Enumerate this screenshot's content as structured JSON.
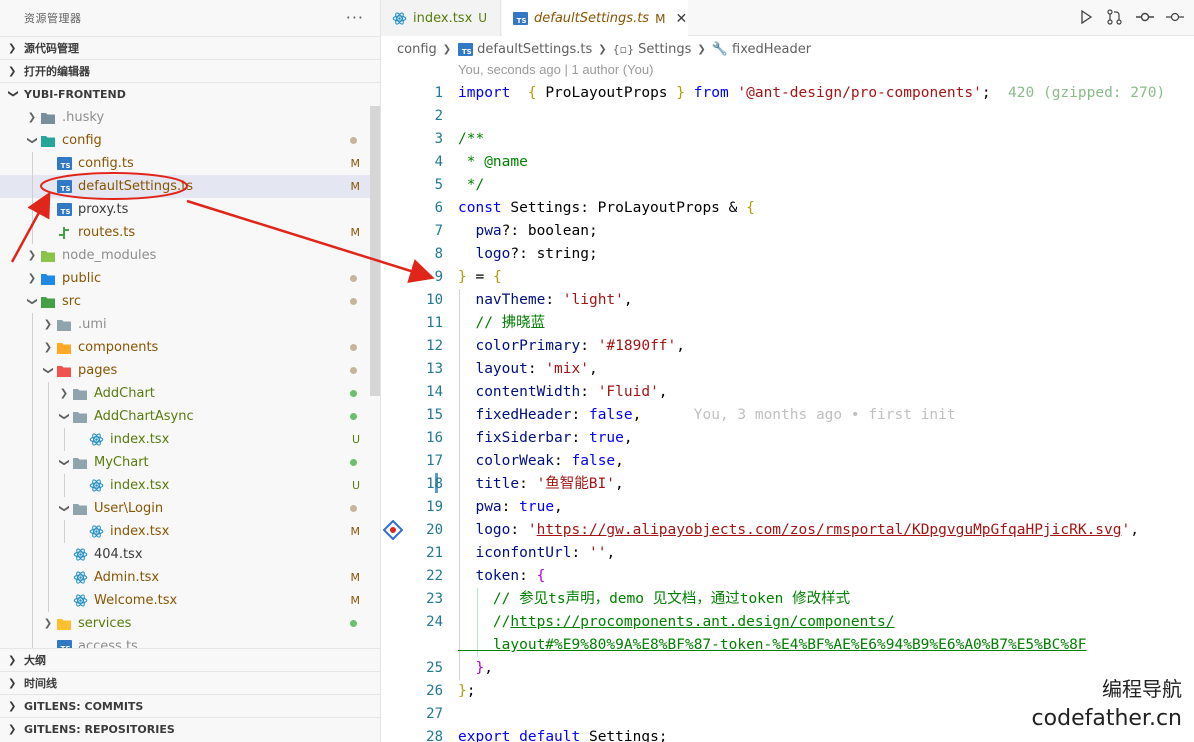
{
  "explorer": {
    "title": "资源管理器",
    "more": "···",
    "sections_top": [
      "源代码管理",
      "打开的编辑器"
    ],
    "root": "YUBI-FRONTEND",
    "tree": [
      {
        "label": "husky",
        "prefix": ".",
        "depth": 1,
        "kind": "folder",
        "exp": false,
        "style": "dim"
      },
      {
        "label": "config",
        "depth": 1,
        "kind": "folder",
        "exp": true,
        "style": "mod",
        "dot": "y"
      },
      {
        "label": "config.ts",
        "depth": 2,
        "kind": "ts",
        "style": "mod",
        "status": "M"
      },
      {
        "label": "defaultSettings.ts",
        "depth": 2,
        "kind": "ts",
        "style": "mod",
        "status": "M",
        "selected": true
      },
      {
        "label": "proxy.ts",
        "depth": 2,
        "kind": "ts",
        "style": ""
      },
      {
        "label": "routes.ts",
        "depth": 2,
        "kind": "route",
        "style": "mod",
        "status": "M"
      },
      {
        "label": "node_modules",
        "depth": 1,
        "kind": "folder",
        "exp": false,
        "style": "dim"
      },
      {
        "label": "public",
        "depth": 1,
        "kind": "folder",
        "exp": false,
        "style": "mod",
        "dot": "y"
      },
      {
        "label": "src",
        "depth": 1,
        "kind": "folder",
        "exp": true,
        "style": "mod",
        "dot": "y"
      },
      {
        "label": ".umi",
        "depth": 2,
        "kind": "folder",
        "exp": false,
        "style": "dim"
      },
      {
        "label": "components",
        "depth": 2,
        "kind": "folder",
        "exp": false,
        "style": "mod",
        "dot": "y"
      },
      {
        "label": "pages",
        "depth": 2,
        "kind": "folder",
        "exp": true,
        "style": "mod",
        "dot": "y"
      },
      {
        "label": "AddChart",
        "depth": 3,
        "kind": "folder",
        "exp": false,
        "style": "unt",
        "dot": "g"
      },
      {
        "label": "AddChartAsync",
        "depth": 3,
        "kind": "folder",
        "exp": true,
        "style": "unt",
        "dot": "g"
      },
      {
        "label": "index.tsx",
        "depth": 4,
        "kind": "react",
        "style": "unt",
        "status": "U"
      },
      {
        "label": "MyChart",
        "depth": 3,
        "kind": "folder",
        "exp": true,
        "style": "unt",
        "dot": "g"
      },
      {
        "label": "index.tsx",
        "depth": 4,
        "kind": "react",
        "style": "unt",
        "status": "U"
      },
      {
        "label": "User\\Login",
        "depth": 3,
        "kind": "folder",
        "exp": true,
        "style": "mod",
        "dot": "y"
      },
      {
        "label": "index.tsx",
        "depth": 4,
        "kind": "react",
        "style": "mod",
        "status": "M"
      },
      {
        "label": "404.tsx",
        "depth": 3,
        "kind": "react",
        "style": ""
      },
      {
        "label": "Admin.tsx",
        "depth": 3,
        "kind": "react",
        "style": "mod",
        "status": "M"
      },
      {
        "label": "Welcome.tsx",
        "depth": 3,
        "kind": "react",
        "style": "mod",
        "status": "M"
      },
      {
        "label": "services",
        "depth": 2,
        "kind": "folder",
        "exp": false,
        "style": "unt",
        "dot": "g"
      },
      {
        "label": "access.ts",
        "depth": 2,
        "kind": "ts",
        "style": "dim"
      }
    ],
    "sections_bottom": [
      "大纲",
      "时间线",
      "GITLENS: COMMITS",
      "GITLENS: REPOSITORIES"
    ]
  },
  "tabs": [
    {
      "label": "index.tsx",
      "status": "U"
    },
    {
      "label": "defaultSettings.ts",
      "status": "M",
      "close": "✕"
    }
  ],
  "breadcrumb": [
    "config",
    "defaultSettings.ts",
    "Settings",
    "fixedHeader"
  ],
  "blame_header": "You, seconds ago | 1 author (You)",
  "code_lines": [
    {
      "n": "1",
      "t": [
        [
          "kw",
          "import"
        ],
        [
          "",
          "  "
        ],
        [
          "br",
          "{"
        ],
        [
          "",
          " ProLayoutProps "
        ],
        [
          "br",
          "}"
        ],
        [
          "",
          " "
        ],
        [
          "kw",
          "from"
        ],
        [
          "",
          " "
        ],
        [
          "str",
          "'@ant-design/pro-components'"
        ],
        [
          "",
          ";  "
        ],
        [
          "sz",
          "420 (gzipped: 270)"
        ]
      ]
    },
    {
      "n": "2",
      "t": []
    },
    {
      "n": "3",
      "t": [
        [
          "cm",
          "/**"
        ]
      ]
    },
    {
      "n": "4",
      "t": [
        [
          "cm",
          " * @name"
        ]
      ]
    },
    {
      "n": "5",
      "t": [
        [
          "cm",
          " */"
        ]
      ]
    },
    {
      "n": "6",
      "t": [
        [
          "kw",
          "const"
        ],
        [
          "",
          " Settings: ProLayoutProps & "
        ],
        [
          "br",
          "{"
        ]
      ]
    },
    {
      "n": "7",
      "t": [
        [
          "tk",
          "  pwa"
        ],
        [
          "",
          "?: boolean;"
        ]
      ]
    },
    {
      "n": "8",
      "t": [
        [
          "tk",
          "  logo"
        ],
        [
          "",
          "?: string;"
        ]
      ]
    },
    {
      "n": "9",
      "t": [
        [
          "br",
          "}"
        ],
        [
          "",
          " = "
        ],
        [
          "br",
          "{"
        ]
      ]
    },
    {
      "n": "10",
      "t": [
        [
          "tk",
          "  navTheme"
        ],
        [
          "",
          ": "
        ],
        [
          "str",
          "'light'"
        ],
        [
          "",
          ","
        ]
      ]
    },
    {
      "n": "11",
      "t": [
        [
          "cm",
          "  // 拂晓蓝"
        ]
      ]
    },
    {
      "n": "12",
      "t": [
        [
          "tk",
          "  colorPrimary"
        ],
        [
          "",
          ": "
        ],
        [
          "str",
          "'#1890ff'"
        ],
        [
          "",
          ","
        ]
      ]
    },
    {
      "n": "13",
      "t": [
        [
          "tk",
          "  layout"
        ],
        [
          "",
          ": "
        ],
        [
          "str",
          "'mix'"
        ],
        [
          "",
          ","
        ]
      ]
    },
    {
      "n": "14",
      "t": [
        [
          "tk",
          "  contentWidth"
        ],
        [
          "",
          ": "
        ],
        [
          "str",
          "'Fluid'"
        ],
        [
          "",
          ","
        ]
      ]
    },
    {
      "n": "15",
      "t": [
        [
          "tk",
          "  fixedHeader"
        ],
        [
          "",
          ": "
        ],
        [
          "kw",
          "false"
        ],
        [
          "",
          ",      "
        ],
        [
          "blame",
          "You, 3 months ago • first init"
        ]
      ]
    },
    {
      "n": "16",
      "t": [
        [
          "tk",
          "  fixSiderbar"
        ],
        [
          "",
          ": "
        ],
        [
          "kw",
          "true"
        ],
        [
          "",
          ","
        ]
      ]
    },
    {
      "n": "17",
      "t": [
        [
          "tk",
          "  colorWeak"
        ],
        [
          "",
          ": "
        ],
        [
          "kw",
          "false"
        ],
        [
          "",
          ","
        ]
      ]
    },
    {
      "n": "18",
      "t": [
        [
          "tk",
          "  title"
        ],
        [
          "",
          ": "
        ],
        [
          "str",
          "'鱼智能BI'"
        ],
        [
          "",
          ","
        ]
      ]
    },
    {
      "n": "19",
      "t": [
        [
          "tk",
          "  pwa"
        ],
        [
          "",
          ": "
        ],
        [
          "kw",
          "true"
        ],
        [
          "",
          ","
        ]
      ]
    },
    {
      "n": "20",
      "t": [
        [
          "tk",
          "  logo"
        ],
        [
          "",
          ": "
        ],
        [
          "str",
          "'"
        ],
        [
          "lnk",
          "https://gw.alipayobjects.com/zos/rmsportal/KDpgvguMpGfqaHPjicRK.svg"
        ],
        [
          "str",
          "'"
        ],
        [
          "",
          ","
        ]
      ]
    },
    {
      "n": "21",
      "t": [
        [
          "tk",
          "  iconfontUrl"
        ],
        [
          "",
          ": "
        ],
        [
          "str",
          "''"
        ],
        [
          "",
          ","
        ]
      ]
    },
    {
      "n": "22",
      "t": [
        [
          "tk",
          "  token"
        ],
        [
          "",
          ": "
        ],
        [
          "br2",
          "{"
        ]
      ]
    },
    {
      "n": "23",
      "t": [
        [
          "cm",
          "    // 参见ts声明，demo 见文档，通过token 修改样式"
        ]
      ]
    },
    {
      "n": "24",
      "t": [
        [
          "cm",
          "    //"
        ],
        [
          "cml",
          "https://procomponents.ant.design/components/"
        ]
      ]
    },
    {
      "n": "",
      "t": [
        [
          "cml",
          "    layout#%E9%80%9A%E8%BF%87-token-%E4%BF%AE%E6%94%B9%E6%A0%B7%E5%BC%8F"
        ]
      ]
    },
    {
      "n": "25",
      "t": [
        [
          "br2",
          "  }"
        ],
        [
          "",
          ","
        ]
      ]
    },
    {
      "n": "26",
      "t": [
        [
          "br",
          "}"
        ],
        [
          "",
          ";"
        ]
      ]
    },
    {
      "n": "27",
      "t": []
    },
    {
      "n": "28",
      "t": [
        [
          "kw",
          "export"
        ],
        [
          "",
          " "
        ],
        [
          "kw",
          "default"
        ],
        [
          "",
          " Settings;"
        ]
      ]
    }
  ],
  "watermark": {
    "line1": "编程导航",
    "line2": "codefather.cn"
  },
  "colors": {
    "accent": "#0000ff",
    "annotation": "#e0261b",
    "modified": "#895503",
    "untracked": "#587c0c"
  }
}
